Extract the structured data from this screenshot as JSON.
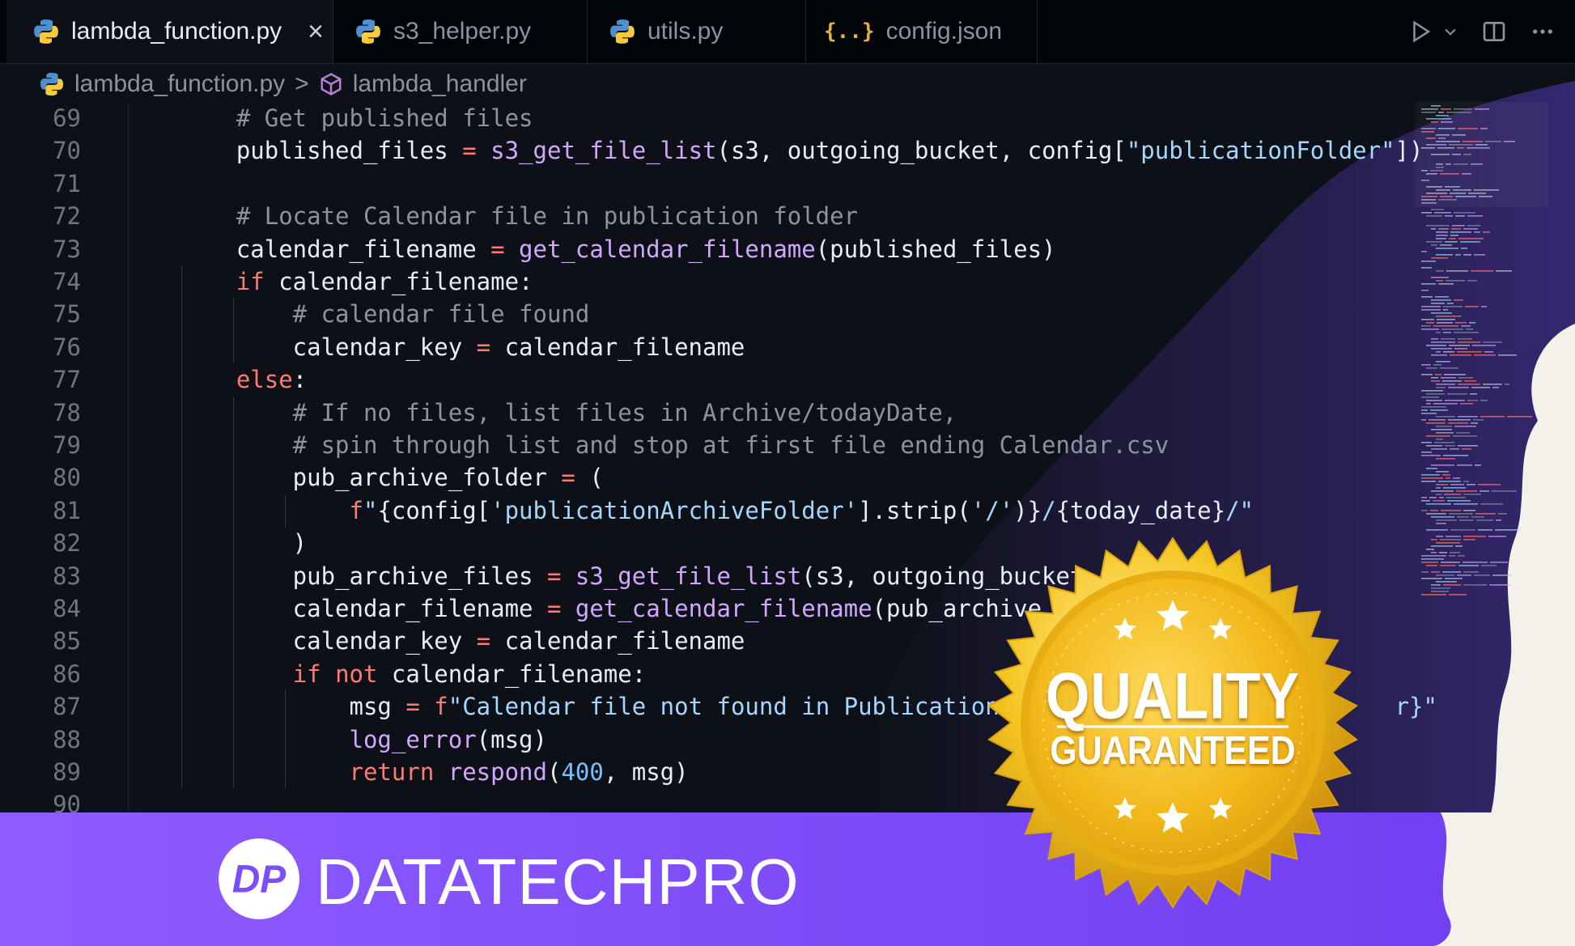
{
  "tabs": [
    {
      "label": "lambda_function.py",
      "icon": "python-icon",
      "active": true
    },
    {
      "label": "s3_helper.py",
      "icon": "python-icon",
      "active": false
    },
    {
      "label": "utils.py",
      "icon": "python-icon",
      "active": false
    },
    {
      "label": "config.json",
      "icon": "json-icon",
      "active": false
    }
  ],
  "json_icon_glyph": "{..}",
  "close_glyph": "×",
  "breadcrumb": {
    "file": "lambda_function.py",
    "symbol": "lambda_handler",
    "separator": ">"
  },
  "code_lines": [
    {
      "n": "69",
      "tokens": [
        {
          "t": "    # Get published files",
          "c": "com"
        }
      ]
    },
    {
      "n": "70",
      "tokens": [
        {
          "t": "    published_files ",
          "c": "var"
        },
        {
          "t": "=",
          "c": "op"
        },
        {
          "t": " ",
          "c": "var"
        },
        {
          "t": "s3_get_file_list",
          "c": "fn"
        },
        {
          "t": "(s3, outgoing_bucket, config[",
          "c": "var"
        },
        {
          "t": "\"publicationFolder\"",
          "c": "str"
        },
        {
          "t": "])",
          "c": "var"
        }
      ]
    },
    {
      "n": "71",
      "tokens": []
    },
    {
      "n": "72",
      "tokens": [
        {
          "t": "    # Locate Calendar file in publication folder",
          "c": "com"
        }
      ]
    },
    {
      "n": "73",
      "tokens": [
        {
          "t": "    calendar_filename ",
          "c": "var"
        },
        {
          "t": "=",
          "c": "op"
        },
        {
          "t": " ",
          "c": "var"
        },
        {
          "t": "get_calendar_filename",
          "c": "fn"
        },
        {
          "t": "(published_files)",
          "c": "var"
        }
      ]
    },
    {
      "n": "74",
      "tokens": [
        {
          "t": "    ",
          "c": "var"
        },
        {
          "t": "if",
          "c": "kw"
        },
        {
          "t": " calendar_filename:",
          "c": "var"
        }
      ]
    },
    {
      "n": "75",
      "tokens": [
        {
          "t": "        # calendar file found",
          "c": "com"
        }
      ]
    },
    {
      "n": "76",
      "tokens": [
        {
          "t": "        calendar_key ",
          "c": "var"
        },
        {
          "t": "=",
          "c": "op"
        },
        {
          "t": " calendar_filename",
          "c": "var"
        }
      ]
    },
    {
      "n": "77",
      "tokens": [
        {
          "t": "    ",
          "c": "var"
        },
        {
          "t": "else",
          "c": "kw"
        },
        {
          "t": ":",
          "c": "var"
        }
      ]
    },
    {
      "n": "78",
      "tokens": [
        {
          "t": "        # If no files, list files in Archive/todayDate,",
          "c": "com"
        }
      ]
    },
    {
      "n": "79",
      "tokens": [
        {
          "t": "        # spin through list and stop at first file ending Calendar.csv",
          "c": "com"
        }
      ]
    },
    {
      "n": "80",
      "tokens": [
        {
          "t": "        pub_archive_folder ",
          "c": "var"
        },
        {
          "t": "=",
          "c": "op"
        },
        {
          "t": " (",
          "c": "var"
        }
      ]
    },
    {
      "n": "81",
      "tokens": [
        {
          "t": "            ",
          "c": "var"
        },
        {
          "t": "f",
          "c": "kw"
        },
        {
          "t": "\"",
          "c": "str"
        },
        {
          "t": "{config[",
          "c": "var"
        },
        {
          "t": "'publicationArchiveFolder'",
          "c": "str"
        },
        {
          "t": "].strip(",
          "c": "var"
        },
        {
          "t": "'/'",
          "c": "str"
        },
        {
          "t": ")}",
          "c": "var"
        },
        {
          "t": "/",
          "c": "str"
        },
        {
          "t": "{today_date}",
          "c": "var"
        },
        {
          "t": "/\"",
          "c": "str"
        }
      ]
    },
    {
      "n": "82",
      "tokens": [
        {
          "t": "        )",
          "c": "var"
        }
      ]
    },
    {
      "n": "83",
      "tokens": [
        {
          "t": "        pub_archive_files ",
          "c": "var"
        },
        {
          "t": "=",
          "c": "op"
        },
        {
          "t": " ",
          "c": "var"
        },
        {
          "t": "s3_get_file_list",
          "c": "fn"
        },
        {
          "t": "(s3, outgoing_bucket, pub_ar",
          "c": "var"
        }
      ]
    },
    {
      "n": "84",
      "tokens": [
        {
          "t": "        calendar_filename ",
          "c": "var"
        },
        {
          "t": "=",
          "c": "op"
        },
        {
          "t": " ",
          "c": "var"
        },
        {
          "t": "get_calendar_filename",
          "c": "fn"
        },
        {
          "t": "(pub_archive_files)",
          "c": "var"
        }
      ]
    },
    {
      "n": "85",
      "tokens": [
        {
          "t": "        calendar_key ",
          "c": "var"
        },
        {
          "t": "=",
          "c": "op"
        },
        {
          "t": " calendar_filename",
          "c": "var"
        }
      ]
    },
    {
      "n": "86",
      "tokens": [
        {
          "t": "        ",
          "c": "var"
        },
        {
          "t": "if not",
          "c": "kw"
        },
        {
          "t": " calendar_filename:",
          "c": "var"
        }
      ]
    },
    {
      "n": "87",
      "tokens": [
        {
          "t": "            msg ",
          "c": "var"
        },
        {
          "t": "=",
          "c": "op"
        },
        {
          "t": " ",
          "c": "var"
        },
        {
          "t": "f",
          "c": "kw"
        },
        {
          "t": "\"Calendar file not found in Publication Archive",
          "c": "str"
        },
        {
          "t": "                    ",
          "c": "var"
        },
        {
          "t": "r}\"",
          "c": "str"
        }
      ]
    },
    {
      "n": "88",
      "tokens": [
        {
          "t": "            ",
          "c": "var"
        },
        {
          "t": "log_error",
          "c": "fn"
        },
        {
          "t": "(msg)",
          "c": "var"
        }
      ]
    },
    {
      "n": "89",
      "tokens": [
        {
          "t": "            ",
          "c": "var"
        },
        {
          "t": "return",
          "c": "kw"
        },
        {
          "t": " ",
          "c": "var"
        },
        {
          "t": "respond",
          "c": "fn"
        },
        {
          "t": "(",
          "c": "var"
        },
        {
          "t": "400",
          "c": "num"
        },
        {
          "t": ", msg)",
          "c": "var"
        }
      ]
    },
    {
      "n": "90",
      "tokens": []
    }
  ],
  "brand": {
    "name": "DATATECHPRO",
    "logo_mark": "DP"
  },
  "badge": {
    "line1": "QUALITY",
    "line2": "GUARANTEED"
  },
  "colors": {
    "editor_bg": "#0d1117",
    "banner_purple": "#7c4dff",
    "badge_gold": "#f5c623",
    "keyword": "#ff7b72",
    "function": "#d2a8ff",
    "string": "#a5d6ff",
    "comment": "#8b949e"
  }
}
